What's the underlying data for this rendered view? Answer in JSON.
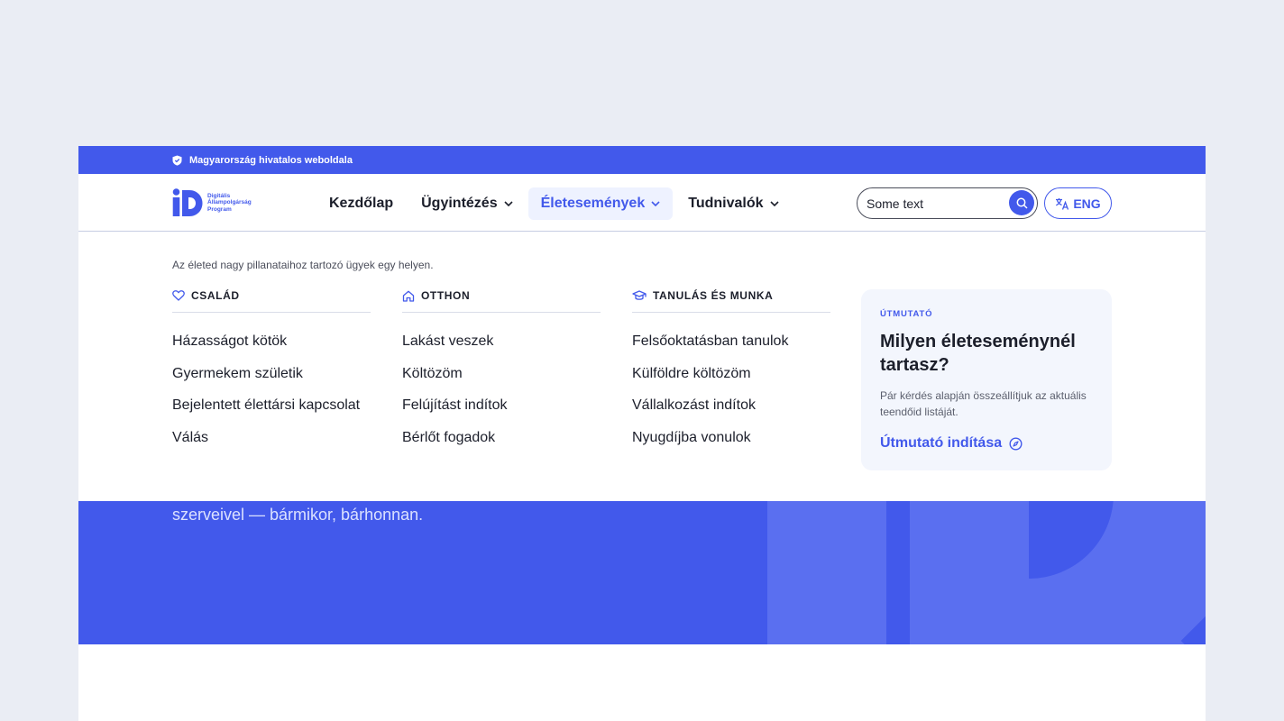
{
  "topbar": {
    "text": "Magyarország hivatalos weboldala"
  },
  "logo": {
    "line1": "Digitális",
    "line2": "Állampolgárság",
    "line3": "Program"
  },
  "nav": {
    "items": [
      {
        "label": "Kezdőlap"
      },
      {
        "label": "Ügyintézés"
      },
      {
        "label": "Életesemények"
      },
      {
        "label": "Tudnivalók"
      }
    ]
  },
  "search": {
    "value": "Some text"
  },
  "lang": {
    "label": "ENG"
  },
  "mega": {
    "intro": "Az életed nagy pillanataihoz tartozó ügyek egy helyen.",
    "columns": [
      {
        "title": "CSALÁD",
        "items": [
          "Házasságot kötök",
          "Gyermekem születik",
          "Bejelentett élettársi kapcsolat",
          "Válás"
        ]
      },
      {
        "title": "OTTHON",
        "items": [
          "Lakást veszek",
          "Költözöm",
          "Felújítást indítok",
          "Bérlőt fogadok"
        ]
      },
      {
        "title": "TANULÁS ÉS MUNKA",
        "items": [
          "Felsőoktatásban tanulok",
          "Külföldre költözöm",
          "Vállalkozást indítok",
          "Nyugdíjba vonulok"
        ]
      }
    ],
    "guide": {
      "kicker": "ÚTMUTATÓ",
      "title": "Milyen életeseménynél tartasz?",
      "text": "Pár kérdés alapján összeállítjuk az aktuális teendőid listáját.",
      "cta": "Útmutató indítása"
    }
  },
  "hero": {
    "lead": "szerveivel — bármikor, bárhonnan."
  },
  "colors": {
    "brand": "#4259eb",
    "guide_bg": "#f3f6fd",
    "page_bg": "#eaedf4"
  }
}
